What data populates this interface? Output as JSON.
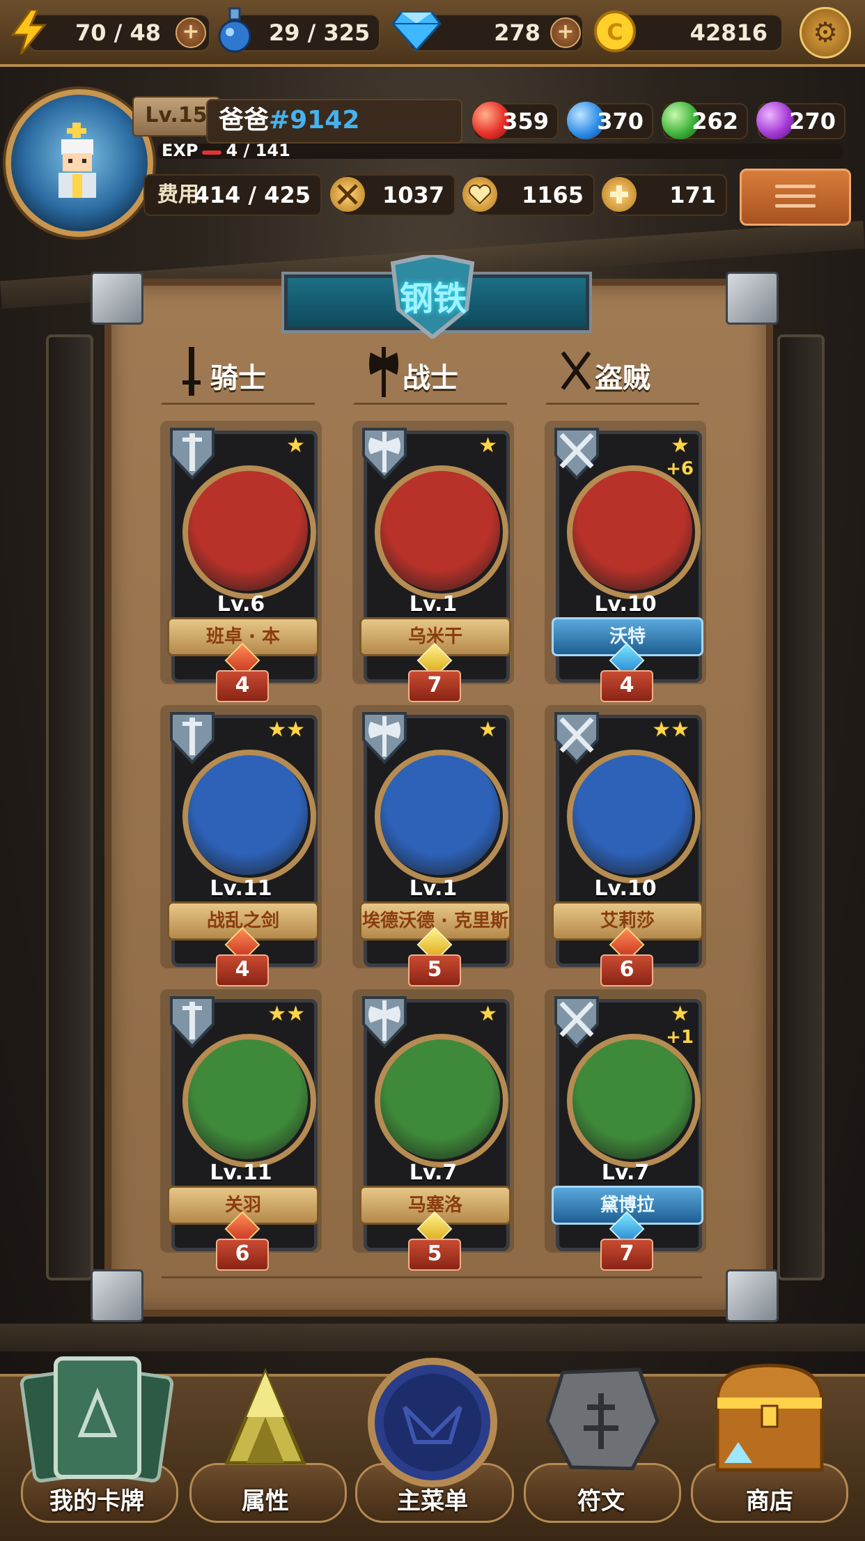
{
  "resources": {
    "energy": "70 / 48",
    "potion": "29 / 325",
    "gems": "278",
    "gold": "42816"
  },
  "player": {
    "level": "Lv.15",
    "name": "爸爸",
    "tag": "#9142",
    "exp_label": "EXP",
    "exp_value": "4 / 141",
    "exp_progress": 0.028,
    "orbs": [
      {
        "name": "fire",
        "value": "359",
        "color": "#e8302a"
      },
      {
        "name": "water",
        "value": "370",
        "color": "#2f8fe8"
      },
      {
        "name": "nature",
        "value": "262",
        "color": "#3fb53a"
      },
      {
        "name": "dark",
        "value": "270",
        "color": "#a53ad6"
      }
    ],
    "cost_label": "费用",
    "cost_value": "414 / 425",
    "attack": "1037",
    "health": "1165",
    "heal": "171"
  },
  "panel": {
    "title": "钢铁",
    "columns": [
      "骑士",
      "战士",
      "盗贼"
    ]
  },
  "cards": [
    {
      "level": "Lv.6",
      "name": "班卓 · 本",
      "stars": "★",
      "plus": "",
      "cost": "4",
      "ribbon": "gold",
      "gem": "red",
      "bg": "#b8322a",
      "class": "knight"
    },
    {
      "level": "Lv.1",
      "name": "乌米干",
      "stars": "★",
      "plus": "",
      "cost": "7",
      "ribbon": "gold",
      "gem": "yellow",
      "bg": "#b8322a",
      "class": "warrior"
    },
    {
      "level": "Lv.10",
      "name": "沃特",
      "stars": "★",
      "plus": "+6",
      "cost": "4",
      "ribbon": "blue",
      "gem": "blue",
      "bg": "#b8322a",
      "class": "rogue"
    },
    {
      "level": "Lv.11",
      "name": "战乱之剑",
      "stars": "★★",
      "plus": "",
      "cost": "4",
      "ribbon": "gold",
      "gem": "red",
      "bg": "#2d62b8",
      "class": "knight"
    },
    {
      "level": "Lv.1",
      "name": "埃德沃德 · 克里斯",
      "stars": "★",
      "plus": "",
      "cost": "5",
      "ribbon": "gold",
      "gem": "yellow",
      "bg": "#2d62b8",
      "class": "warrior"
    },
    {
      "level": "Lv.10",
      "name": "艾莉莎",
      "stars": "★★",
      "plus": "",
      "cost": "6",
      "ribbon": "gold",
      "gem": "red",
      "bg": "#2d62b8",
      "class": "rogue"
    },
    {
      "level": "Lv.11",
      "name": "关羽",
      "stars": "★★",
      "plus": "",
      "cost": "6",
      "ribbon": "gold",
      "gem": "red",
      "bg": "#3f8a3a",
      "class": "knight"
    },
    {
      "level": "Lv.7",
      "name": "马塞洛",
      "stars": "★",
      "plus": "",
      "cost": "5",
      "ribbon": "gold",
      "gem": "yellow",
      "bg": "#3f8a3a",
      "class": "warrior"
    },
    {
      "level": "Lv.7",
      "name": "黛博拉",
      "stars": "★",
      "plus": "+1",
      "cost": "7",
      "ribbon": "blue",
      "gem": "blue",
      "bg": "#3f8a3a",
      "class": "rogue"
    }
  ],
  "nav": [
    "我的卡牌",
    "属性",
    "主菜单",
    "符文",
    "商店"
  ],
  "icons": {
    "energy": "lightning-icon",
    "potion": "potion-icon",
    "gems": "diamond-icon",
    "gold": "coin-icon",
    "settings": "gear-icon",
    "attack": "crossed-swords-icon",
    "health": "heart-icon",
    "heal": "cross-icon",
    "menu": "hamburger-icon"
  }
}
